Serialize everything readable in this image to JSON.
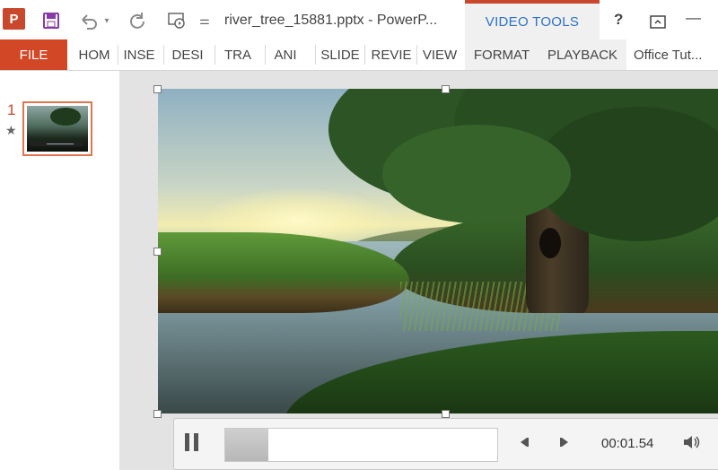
{
  "titlebar": {
    "app_logo": "P",
    "title": "river_tree_15881.pptx - PowerP...",
    "context_group": "VIDEO TOOLS",
    "help": "?",
    "minimize": "—",
    "icons": [
      "powerpoint-logo-icon",
      "save-icon",
      "undo-icon",
      "redo-icon",
      "from-beginning-icon",
      "customize-icon",
      "restore-icon"
    ]
  },
  "ribbon": {
    "tabs": [
      "FILE",
      "HOM",
      "INSE",
      "DESI",
      "TRA",
      "ANI",
      "SLIDE",
      "REVIE",
      "VIEW",
      "FORMAT",
      "PLAYBACK",
      "Office Tut..."
    ]
  },
  "slides": {
    "number": "1",
    "star": "★"
  },
  "player": {
    "time": "00:01.54",
    "progress": 0.16,
    "controls": [
      "pause-icon",
      "step-back-icon",
      "step-forward-icon",
      "volume-icon"
    ]
  },
  "colors": {
    "accent": "#c9472c",
    "file_tab": "#d24726",
    "context_text": "#2b72c9"
  }
}
